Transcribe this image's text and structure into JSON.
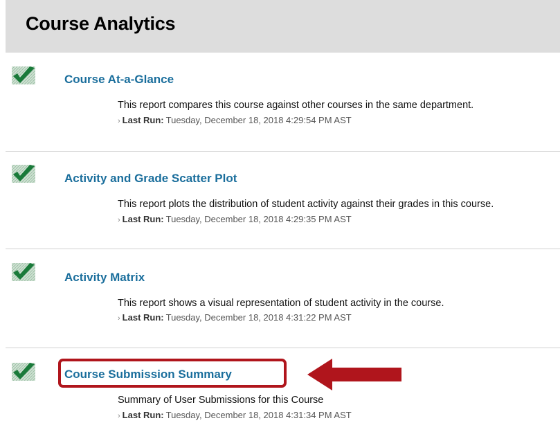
{
  "page": {
    "title": "Course Analytics"
  },
  "reports": [
    {
      "title": "Course At-a-Glance",
      "description": "This report compares this course against other courses in the same department.",
      "last_run_label": "Last Run:",
      "last_run_value": "Tuesday, December 18, 2018 4:29:54 PM AST"
    },
    {
      "title": "Activity and Grade Scatter Plot",
      "description": "This report plots the distribution of student activity against their grades in this course.",
      "last_run_label": "Last Run:",
      "last_run_value": "Tuesday, December 18, 2018 4:29:35 PM AST"
    },
    {
      "title": "Activity Matrix",
      "description": "This report shows a visual representation of student activity in the course.",
      "last_run_label": "Last Run:",
      "last_run_value": "Tuesday, December 18, 2018 4:31:22 PM AST"
    },
    {
      "title": "Course Submission Summary",
      "description": "Summary of User Submissions for this Course",
      "last_run_label": "Last Run:",
      "last_run_value": "Tuesday, December 18, 2018 4:31:34 PM AST"
    }
  ],
  "icons": {
    "check": "checkmark-icon",
    "chevron": "chevron-right-icon",
    "arrow": "arrow-left-icon"
  },
  "colors": {
    "link": "#1a6e9c",
    "check": "#1a7a3a",
    "highlight": "#b0151c",
    "header_bg": "#dddddd"
  }
}
